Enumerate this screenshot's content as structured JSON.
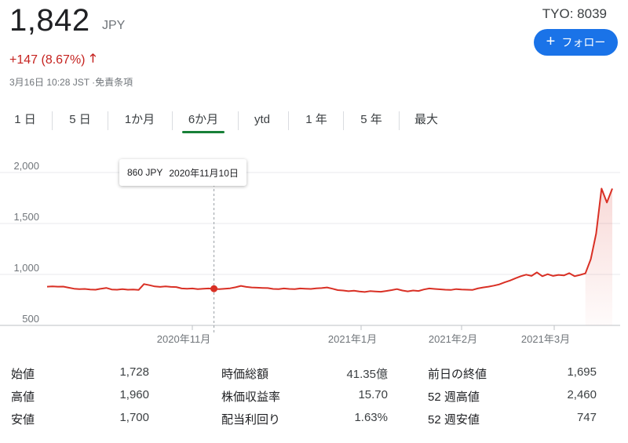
{
  "header": {
    "price": "1,842",
    "currency": "JPY",
    "ticker": "TYO: 8039",
    "change": "+147 (8.67%)",
    "timestamp": "3月16日 10:28 JST ·免責条項",
    "follow_label": "フォロー",
    "change_color": "#c5221f"
  },
  "tabs": [
    {
      "label": "1 日"
    },
    {
      "label": "5 日"
    },
    {
      "label": "1か月"
    },
    {
      "label": "6か月",
      "active": true
    },
    {
      "label": "ytd"
    },
    {
      "label": "1 年"
    },
    {
      "label": "5 年"
    },
    {
      "label": "最大"
    }
  ],
  "tooltip": {
    "price": "860 JPY",
    "date": "2020年11月10日"
  },
  "chart_data": {
    "type": "line",
    "y_ticks": [
      "2,000",
      "1,500",
      "1,000",
      "500"
    ],
    "ylim": [
      500,
      2000
    ],
    "x_ticks": [
      "2020年11月",
      "2021年1月",
      "2021年2月",
      "2021年3月"
    ],
    "line_color": "#d93025",
    "grid": true,
    "values": [
      880,
      882,
      880,
      881,
      870,
      860,
      855,
      858,
      852,
      850,
      860,
      868,
      852,
      850,
      855,
      850,
      852,
      848,
      905,
      895,
      882,
      878,
      882,
      878,
      876,
      862,
      860,
      862,
      855,
      860,
      862,
      858,
      855,
      860,
      864,
      874,
      888,
      878,
      872,
      870,
      868,
      866,
      858,
      855,
      862,
      858,
      856,
      862,
      860,
      858,
      864,
      866,
      872,
      860,
      846,
      842,
      835,
      840,
      832,
      828,
      836,
      833,
      830,
      838,
      846,
      856,
      842,
      834,
      842,
      838,
      852,
      862,
      858,
      854,
      850,
      848,
      856,
      852,
      850,
      848,
      862,
      872,
      880,
      890,
      902,
      922,
      940,
      962,
      982,
      998,
      985,
      1020,
      982,
      1002,
      985,
      995,
      990,
      1012,
      982,
      995,
      1010,
      1150,
      1400,
      1842,
      1705,
      1842
    ],
    "highlight": {
      "index": 31,
      "value": 860
    }
  },
  "stats": [
    [
      {
        "label": "始値",
        "value": "1,728"
      },
      {
        "label": "時価総額",
        "value": "41.35億"
      },
      {
        "label": "前日の終値",
        "value": "1,695"
      }
    ],
    [
      {
        "label": "高値",
        "value": "1,960"
      },
      {
        "label": "株価収益率",
        "value": "15.70"
      },
      {
        "label": "52 週高値",
        "value": "2,460"
      }
    ],
    [
      {
        "label": "安値",
        "value": "1,700"
      },
      {
        "label": "配当利回り",
        "value": "1.63%"
      },
      {
        "label": "52 週安値",
        "value": "747"
      }
    ]
  ]
}
